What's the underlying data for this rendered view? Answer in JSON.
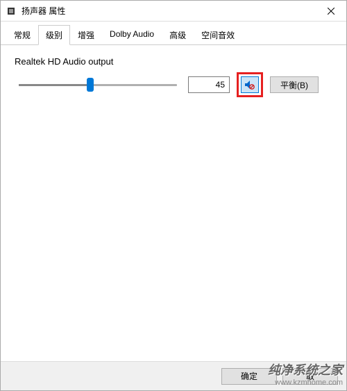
{
  "window": {
    "title": "扬声器 属性"
  },
  "tabs": {
    "items": [
      {
        "label": "常规"
      },
      {
        "label": "级别"
      },
      {
        "label": "增强"
      },
      {
        "label": "Dolby Audio"
      },
      {
        "label": "高级"
      },
      {
        "label": "空间音效"
      }
    ],
    "active_index": 1
  },
  "level": {
    "device_label": "Realtek HD Audio output",
    "value": "45",
    "balance_label": "平衡(B)"
  },
  "footer": {
    "ok": "确定",
    "cancel": "取"
  },
  "watermark": {
    "title": "纯净系统之家",
    "url": "www.kzmhome.com"
  }
}
